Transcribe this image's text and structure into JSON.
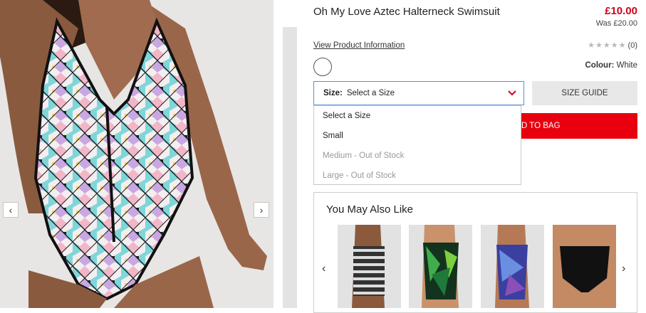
{
  "product": {
    "title": "Oh My Love Aztec Halterneck Swimsuit",
    "price": "£10.00",
    "was_price": "Was £20.00",
    "view_info_link": "View Product Information",
    "rating_count": "(0)",
    "stars": [
      "★",
      "★",
      "★",
      "★",
      "★"
    ],
    "colour_label": "Colour:",
    "colour_value": "White",
    "size_label": "Size:",
    "size_value": "Select a Size",
    "size_guide": "SIZE GUIDE",
    "add_to_bag": "D TO BAG"
  },
  "size_options": [
    {
      "label": "Select a Size",
      "available": true
    },
    {
      "label": "Small",
      "available": true
    },
    {
      "label": "Medium - Out of Stock",
      "available": false
    },
    {
      "label": "Large - Out of Stock",
      "available": false
    }
  ],
  "gallery": {
    "prev_glyph": "‹",
    "next_glyph": "›"
  },
  "recommendations": {
    "title": "You May Also Like",
    "prev_glyph": "‹",
    "next_glyph": "›",
    "items": [
      {
        "name": "striped-swimsuit"
      },
      {
        "name": "tropical-print-swimsuit"
      },
      {
        "name": "purple-print-swimsuit"
      },
      {
        "name": "black-bikini-bottoms"
      }
    ]
  },
  "colors": {
    "accent_red": "#d0021b",
    "add_bag_red": "#e8000f",
    "select_border": "#5b8fd6"
  }
}
